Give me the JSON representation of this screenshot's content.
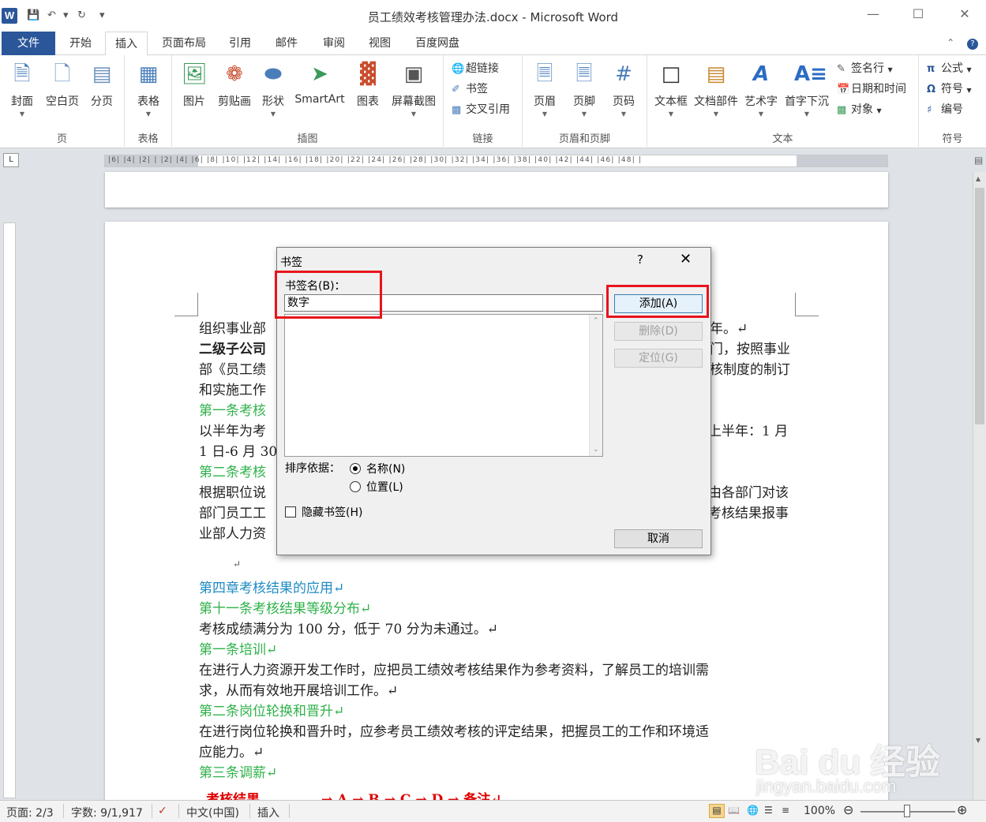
{
  "window": {
    "title": "员工绩效考核管理办法.docx - Microsoft Word",
    "app_icon": "W"
  },
  "tabs": [
    {
      "label": "文件"
    },
    {
      "label": "开始"
    },
    {
      "label": "插入"
    },
    {
      "label": "页面布局"
    },
    {
      "label": "引用"
    },
    {
      "label": "邮件"
    },
    {
      "label": "审阅"
    },
    {
      "label": "视图"
    },
    {
      "label": "百度网盘"
    }
  ],
  "ribbon": {
    "groups": {
      "page": {
        "label": "页",
        "buttons": [
          "封面",
          "空白页",
          "分页"
        ]
      },
      "table": {
        "label": "表格",
        "buttons": [
          "表格"
        ]
      },
      "illustrations": {
        "label": "插图",
        "buttons": [
          "图片",
          "剪贴画",
          "形状",
          "SmartArt",
          "图表",
          "屏幕截图"
        ]
      },
      "links": {
        "label": "链接",
        "buttons": [
          "超链接",
          "书签",
          "交叉引用"
        ]
      },
      "headerfooter": {
        "label": "页眉和页脚",
        "buttons": [
          "页眉",
          "页脚",
          "页码"
        ]
      },
      "text": {
        "label": "文本",
        "buttons": [
          "文本框",
          "文档部件",
          "艺术字",
          "首字下沉"
        ],
        "small": [
          "签名行",
          "日期和时间",
          "对象"
        ]
      },
      "symbols": {
        "label": "符号",
        "small": [
          "公式",
          "符号",
          "编号"
        ]
      }
    }
  },
  "ruler": {
    "ticks": "|6| |4| |2| | |2| |4| |6| |8| |10| |12| |14| |16| |18| |20| |22| |24| |26| |28| |30| |32| |34| |36| |38| |40| |42| |44| |46| |48| |"
  },
  "document": {
    "lines": [
      {
        "text": "组织事业部",
        "style": "normal"
      },
      {
        "text": "年。↵",
        "style": "normal"
      },
      {
        "text": "二级子公司",
        "style": "bold"
      },
      {
        "text": "门，按照事业",
        "style": "normal"
      },
      {
        "text": "部《员工绩",
        "style": "normal"
      },
      {
        "text": "核制度的制订",
        "style": "normal"
      },
      {
        "text": "和实施工作",
        "style": "normal"
      },
      {
        "text": "第一条考核",
        "style": "green"
      },
      {
        "text": "以半年为考",
        "style": "normal"
      },
      {
        "text": "上半年：1 月",
        "style": "normal"
      },
      {
        "text": "1 日-6 月 30",
        "style": "normal"
      },
      {
        "text": "第二条考核",
        "style": "green"
      },
      {
        "text": "根据职位说",
        "style": "normal"
      },
      {
        "text": "由各部门对该",
        "style": "normal"
      },
      {
        "text": "部门员工工",
        "style": "normal"
      },
      {
        "text": "考核结果报事",
        "style": "normal"
      },
      {
        "text": "业部人力资",
        "style": "normal"
      },
      {
        "text": "↵",
        "style": "normal"
      },
      {
        "text": "第四章考核结果的应用↵",
        "style": "blue"
      },
      {
        "text": "第十一条考核结果等级分布↵",
        "style": "green"
      },
      {
        "text": "考核成绩满分为 100 分，低于 70 分为未通过。↵",
        "style": "normal"
      },
      {
        "text": "第一条培训↵",
        "style": "green"
      },
      {
        "text": "在进行人力资源开发工作时，应把员工绩效考核结果作为参考资料，了解员工的培训需",
        "style": "normal"
      },
      {
        "text": "求，从而有效地开展培训工作。↵",
        "style": "normal"
      },
      {
        "text": "第二条岗位轮换和晋升↵",
        "style": "green"
      },
      {
        "text": "在进行岗位轮换和晋升时，应参考员工绩效考核的评定结果，把握员工的工作和环境适",
        "style": "normal"
      },
      {
        "text": "应能力。↵",
        "style": "normal"
      },
      {
        "text": "第三条调薪↵",
        "style": "green"
      },
      {
        "text": "考核结果",
        "style": "red"
      },
      {
        "text": "→    A  →  B  →  C  →  D  →  备注↵",
        "style": "red"
      }
    ]
  },
  "dialog": {
    "title": "书签",
    "help": "?",
    "close": "✕",
    "name_label": "书签名(B)：",
    "name_value": "数字",
    "buttons": {
      "add": "添加(A)",
      "delete": "删除(D)",
      "goto": "定位(G)",
      "cancel": "取消"
    },
    "sort_label": "排序依据：",
    "sort_options": [
      "名称(N)",
      "位置(L)"
    ],
    "hidden_label": "隐藏书签(H)"
  },
  "statusbar": {
    "page": "页面: 2/3",
    "words": "字数: 9/1,917",
    "language": "中文(中国)",
    "mode": "插入",
    "zoom": "100%"
  },
  "watermark": {
    "line1": "Bai du 经验",
    "line2": "jingyan.baidu.com"
  }
}
